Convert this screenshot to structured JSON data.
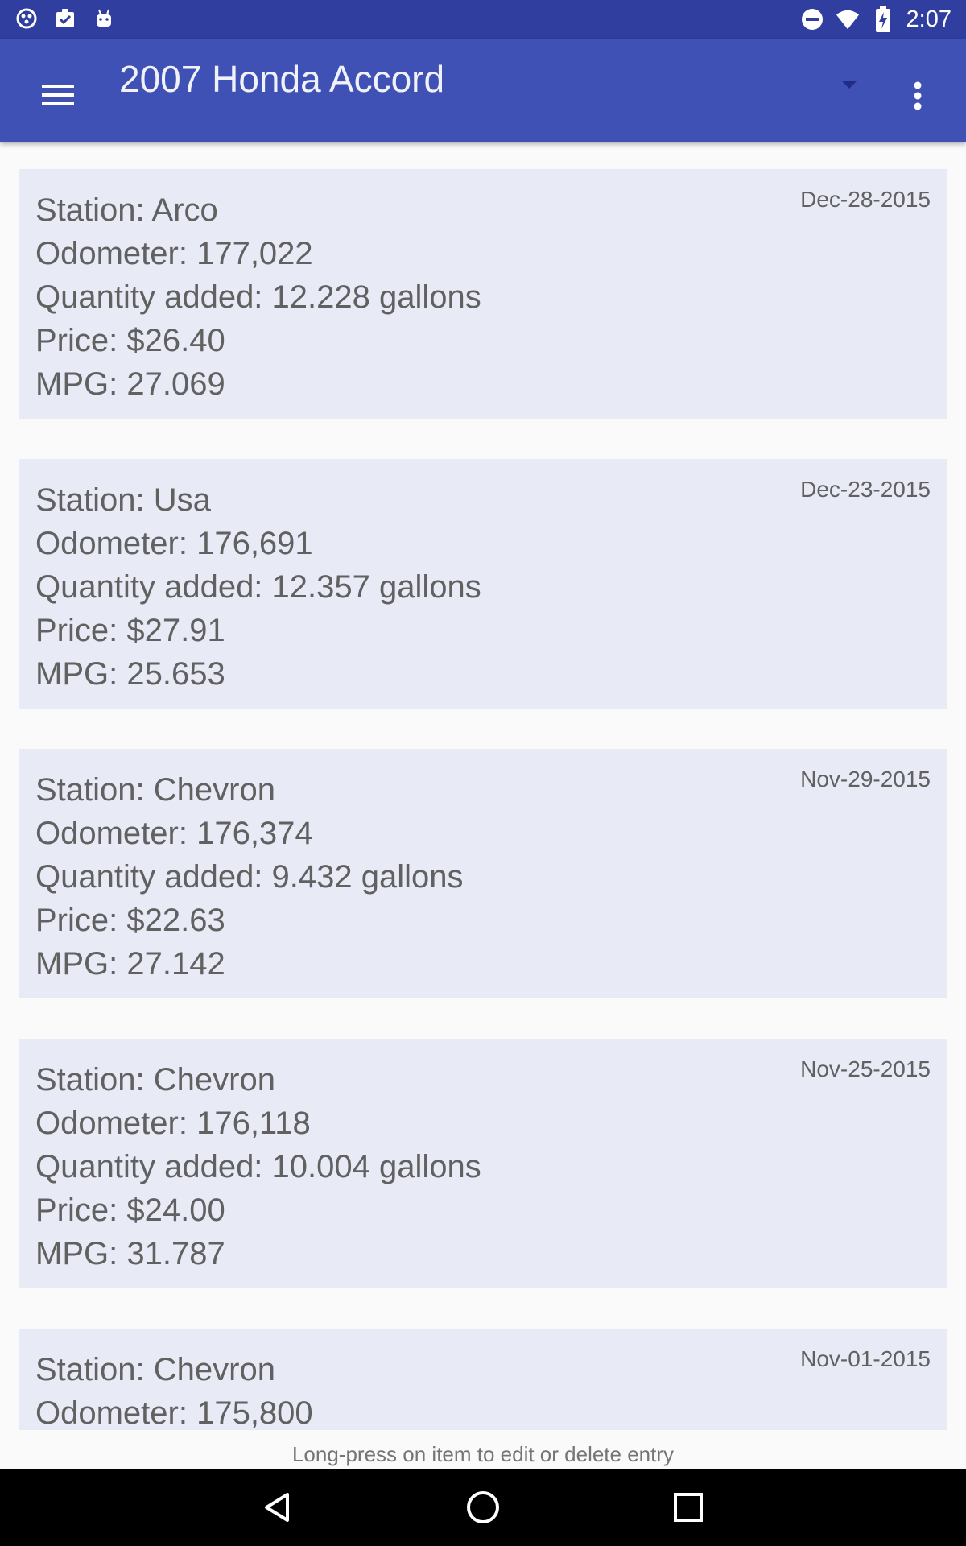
{
  "statusbar": {
    "left_icons": [
      "cluster-icon",
      "clipboard-check-icon",
      "android-icon"
    ],
    "right_icons": [
      "do-not-disturb-icon",
      "wifi-icon",
      "battery-charging-icon"
    ],
    "time": "2:07"
  },
  "appbar": {
    "title": "2007 Honda Accord",
    "menu_icon": "hamburger-menu-icon",
    "dropdown_icon": "dropdown-arrow-icon",
    "overflow_icon": "overflow-menu-icon"
  },
  "entries": [
    {
      "station": "Station: Arco",
      "odometer": "Odometer: 177,022",
      "quantity": "Quantity added: 12.228 gallons",
      "price": "Price: $26.40",
      "mpg": "MPG: 27.069",
      "date": "Dec-28-2015"
    },
    {
      "station": "Station: Usa",
      "odometer": "Odometer: 176,691",
      "quantity": "Quantity added: 12.357 gallons",
      "price": "Price: $27.91",
      "mpg": "MPG: 25.653",
      "date": "Dec-23-2015"
    },
    {
      "station": "Station: Chevron",
      "odometer": "Odometer: 176,374",
      "quantity": "Quantity added: 9.432 gallons",
      "price": "Price: $22.63",
      "mpg": "MPG: 27.142",
      "date": "Nov-29-2015"
    },
    {
      "station": "Station: Chevron",
      "odometer": "Odometer: 176,118",
      "quantity": "Quantity added: 10.004 gallons",
      "price": "Price: $24.00",
      "mpg": "MPG: 31.787",
      "date": "Nov-25-2015"
    },
    {
      "station": "Station: Chevron",
      "odometer": "Odometer: 175,800",
      "date": "Nov-01-2015"
    }
  ],
  "hint": "Long-press on item to edit or delete entry",
  "colors": {
    "statusbar": "#303f9f",
    "appbar": "#3f51b5",
    "card": "#e8eaf6",
    "text": "#616161"
  }
}
